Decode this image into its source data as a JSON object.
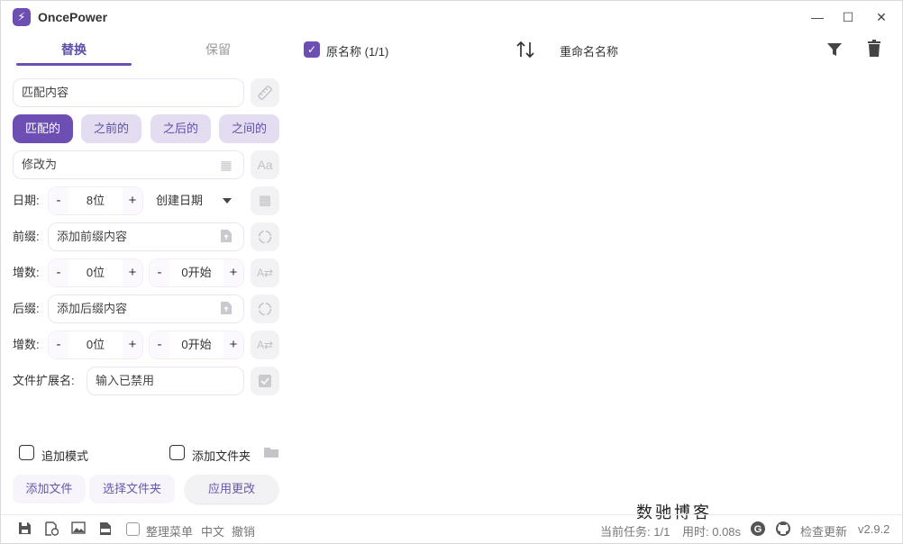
{
  "app": {
    "title": "OncePower",
    "logo_glyph": "⚡",
    "version": "v2.9.2"
  },
  "window_controls": {
    "minimize": "—",
    "maximize": "☐",
    "close": "✕"
  },
  "tabs": [
    {
      "label": "替换",
      "active": true
    },
    {
      "label": "保留",
      "active": false
    }
  ],
  "match": {
    "placeholder": "匹配内容"
  },
  "chips": [
    "匹配的",
    "之前的",
    "之后的",
    "之间的"
  ],
  "modify": {
    "placeholder": "修改为"
  },
  "date": {
    "label": "日期:",
    "minus": "-",
    "value": "8位",
    "plus": "+",
    "select_value": "创建日期"
  },
  "prefix": {
    "label": "前缀:",
    "placeholder": "添加前缀内容"
  },
  "increment1": {
    "label": "增数:",
    "digits": "0位",
    "start": "0开始"
  },
  "suffix": {
    "label": "后缀:",
    "placeholder": "添加后缀内容"
  },
  "increment2": {
    "label": "增数:",
    "digits": "0位",
    "start": "0开始"
  },
  "extension": {
    "label": "文件扩展名:",
    "placeholder": "输入已禁用"
  },
  "options": {
    "append_mode": "追加模式",
    "add_folder": "添加文件夹"
  },
  "actions": {
    "add_file": "添加文件",
    "select_folder": "选择文件夹",
    "apply": "应用更改"
  },
  "list_header": {
    "original": "原名称 (1/1)",
    "renamed": "重命名名称",
    "original_checked": true
  },
  "statusbar": {
    "organize_menu": "整理菜单",
    "language": "中文",
    "undo": "撤销",
    "task": "当前任务: 1/1",
    "time": "用时: 0.08s",
    "check_update": "检查更新"
  },
  "watermark": "数驰博客",
  "colors": {
    "accent": "#6d4fb3",
    "chip_light": "#e4ddf2"
  }
}
